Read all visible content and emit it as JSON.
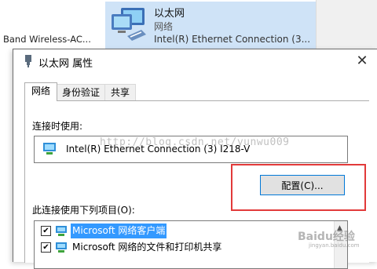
{
  "background_window": {
    "left_adapter_name": "Band Wireless-AC...",
    "selected": {
      "name": "以太网",
      "type": "网络",
      "device": "Intel(R) Ethernet Connection (3..."
    }
  },
  "dialog": {
    "title": "以太网 属性",
    "close_icon": "✕",
    "tabs": [
      {
        "label": "网络",
        "active": true
      },
      {
        "label": "身份验证",
        "active": false
      },
      {
        "label": "共享",
        "active": false
      }
    ],
    "connect_using_label": "连接时使用:",
    "adapter": "Intel(R) Ethernet Connection (3) I218-V",
    "watermark": "http://blog.csdn.net/yunwu009",
    "configure_button": "配置(C)...",
    "items_label": "此连接使用下列项目(O):",
    "items": [
      {
        "checked": true,
        "label": "Microsoft 网络客户端",
        "selected": true
      },
      {
        "checked": true,
        "label": "Microsoft 网络的文件和打印机共享",
        "selected": false
      }
    ],
    "scroll_up_icon": "▲"
  },
  "overlay": {
    "brand": "Baidu经验",
    "brand_url": "jingyan.baidu.com"
  },
  "colors": {
    "selection_bg": "#cfe3f7",
    "list_selection": "#3399ff",
    "highlight_box": "#e23a3a",
    "button_focus": "#0078d7"
  }
}
